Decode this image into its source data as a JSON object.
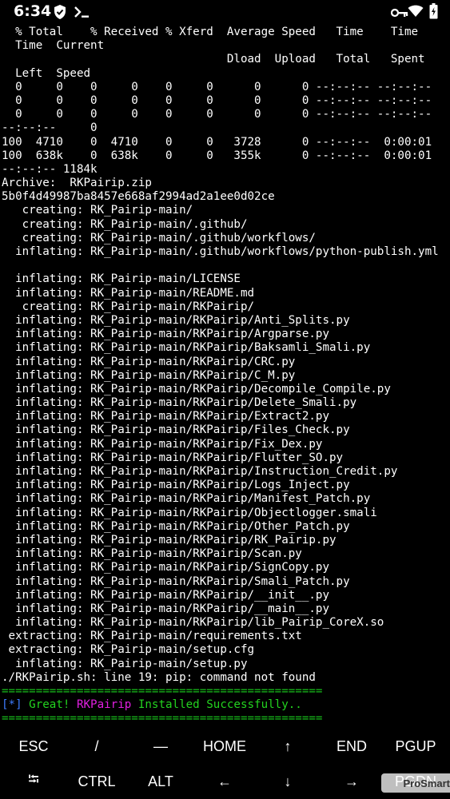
{
  "status_bar": {
    "time": "6:34",
    "left_icons": [
      "shield-icon",
      "terminal-prompt-icon"
    ],
    "right_icons": [
      "key-icon",
      "wifi-icon",
      "battery-icon"
    ]
  },
  "terminal": {
    "lines": [
      "  % Total    % Received % Xferd  Average Speed   Time    Time",
      "  Time  Current",
      "                                 Dload  Upload   Total   Spent",
      "  Left  Speed",
      "  0     0    0     0    0     0      0      0 --:--:-- --:--:--",
      "  0     0    0     0    0     0      0      0 --:--:-- --:--:--",
      "  0     0    0     0    0     0      0      0 --:--:-- --:--:--",
      "--:--:--     0",
      "100  4710    0  4710    0     0   3728      0 --:--:--  0:00:01",
      "100  638k    0  638k    0     0   355k      0 --:--:--  0:00:01",
      "--:--:-- 1184k",
      "Archive:  RKPairip.zip",
      "5b0f4d49987ba8457e668af2994ad2a1ee0d02ce",
      "   creating: RK_Pairip-main/",
      "   creating: RK_Pairip-main/.github/",
      "   creating: RK_Pairip-main/.github/workflows/",
      "  inflating: RK_Pairip-main/.github/workflows/python-publish.yml",
      "",
      "  inflating: RK_Pairip-main/LICENSE",
      "  inflating: RK_Pairip-main/README.md",
      "   creating: RK_Pairip-main/RKPairip/",
      "  inflating: RK_Pairip-main/RKPairip/Anti_Splits.py",
      "  inflating: RK_Pairip-main/RKPairip/Argparse.py",
      "  inflating: RK_Pairip-main/RKPairip/Baksamli_Smali.py",
      "  inflating: RK_Pairip-main/RKPairip/CRC.py",
      "  inflating: RK_Pairip-main/RKPairip/C_M.py",
      "  inflating: RK_Pairip-main/RKPairip/Decompile_Compile.py",
      "  inflating: RK_Pairip-main/RKPairip/Delete_Smali.py",
      "  inflating: RK_Pairip-main/RKPairip/Extract2.py",
      "  inflating: RK_Pairip-main/RKPairip/Files_Check.py",
      "  inflating: RK_Pairip-main/RKPairip/Fix_Dex.py",
      "  inflating: RK_Pairip-main/RKPairip/Flutter_SO.py",
      "  inflating: RK_Pairip-main/RKPairip/Instruction_Credit.py",
      "  inflating: RK_Pairip-main/RKPairip/Logs_Inject.py",
      "  inflating: RK_Pairip-main/RKPairip/Manifest_Patch.py",
      "  inflating: RK_Pairip-main/RKPairip/Objectlogger.smali",
      "  inflating: RK_Pairip-main/RKPairip/Other_Patch.py",
      "  inflating: RK_Pairip-main/RKPairip/RK_Pairip.py",
      "  inflating: RK_Pairip-main/RKPairip/Scan.py",
      "  inflating: RK_Pairip-main/RKPairip/SignCopy.py",
      "  inflating: RK_Pairip-main/RKPairip/Smali_Patch.py",
      "  inflating: RK_Pairip-main/RKPairip/__init__.py",
      "  inflating: RK_Pairip-main/RKPairip/__main__.py",
      "  inflating: RK_Pairip-main/RKPairip/lib_Pairip_CoreX.so",
      " extracting: RK_Pairip-main/requirements.txt",
      " extracting: RK_Pairip-main/setup.cfg",
      "  inflating: RK_Pairip-main/setup.py",
      "./RKPairip.sh: line 19: pip: command not found"
    ],
    "separator": "===============================================",
    "success_line": {
      "marker": "[*]",
      "pre": " Great! ",
      "brand": "RKPairip",
      "post": " Installed Successfully.."
    },
    "colors": {
      "separator": "#17c21b",
      "marker": "#3d7cff",
      "success": "#23d21f",
      "brand": "#e11fe0"
    }
  },
  "extra_keys": {
    "row1": [
      "ESC",
      "/",
      "—",
      "HOME",
      "↑",
      "END",
      "PGUP"
    ],
    "row2": [
      "⭾",
      "CTRL",
      "ALT",
      "←",
      "↓",
      "→",
      "PGDN"
    ]
  },
  "watermark": "ProSmart"
}
